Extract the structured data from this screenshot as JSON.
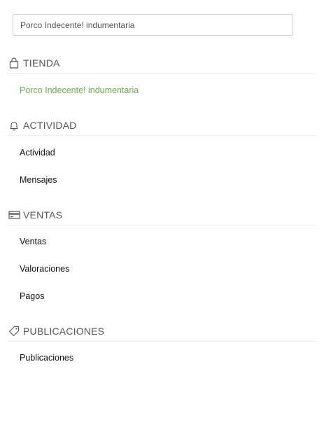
{
  "search": {
    "value": "Porco Indecente! indumentaria",
    "placeholder": ""
  },
  "sections": {
    "tienda": {
      "title": "TIENDA",
      "icon": "bag-icon",
      "items": [
        {
          "label": "Porco Indecente! indumentaria",
          "color": "#6aa84f"
        }
      ]
    },
    "actividad": {
      "title": "ACTIVIDAD",
      "icon": "bell-icon",
      "items": [
        {
          "label": "Actividad"
        },
        {
          "label": "Mensajes"
        }
      ]
    },
    "ventas": {
      "title": "VENTAS",
      "icon": "credit-card-icon",
      "items": [
        {
          "label": "Ventas"
        },
        {
          "label": "Valoraciones"
        },
        {
          "label": "Pagos"
        }
      ]
    },
    "publicaciones": {
      "title": "PUBLICACIONES",
      "icon": "tag-icon",
      "items": [
        {
          "label": "Publicaciones"
        }
      ]
    }
  },
  "colors": {
    "accent_green": "#6aa84f",
    "divider": "#ececec",
    "header_text": "#555555"
  }
}
